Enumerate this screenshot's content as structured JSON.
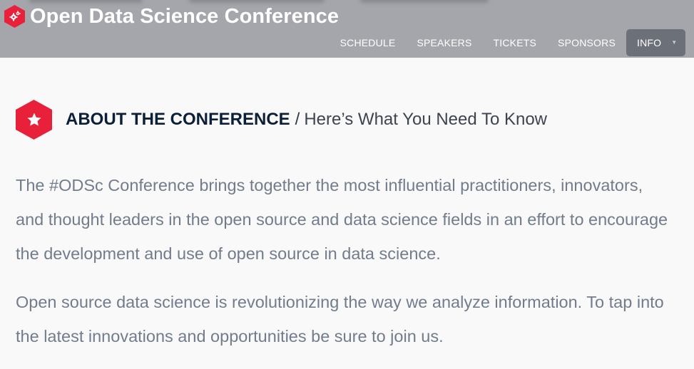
{
  "header": {
    "brand_title": "Open Data Science Conference",
    "brand_icon": "gears-icon",
    "nav": [
      {
        "label": "SCHEDULE"
      },
      {
        "label": "SPEAKERS"
      },
      {
        "label": "TICKETS"
      },
      {
        "label": "SPONSORS"
      },
      {
        "label": "INFO"
      }
    ],
    "active_nav": "INFO",
    "bg_color": "#a4a6ab",
    "active_bg_color": "#6c7079"
  },
  "section": {
    "icon": "star-icon",
    "title": "ABOUT THE CONFERENCE",
    "separator": "/",
    "subtitle": "Here’s What You Need To Know",
    "accent_color": "#e8203a"
  },
  "body": {
    "paragraphs": [
      "The #ODSc Conference brings together the most influential practitioners, innovators, and thought leaders in the open source and data science fields in an effort to encourage the development and use of open source in data science.",
      "Open source data science is revolutionizing the way we analyze information. To tap into the latest innovations and opportunities be sure to join us."
    ]
  }
}
